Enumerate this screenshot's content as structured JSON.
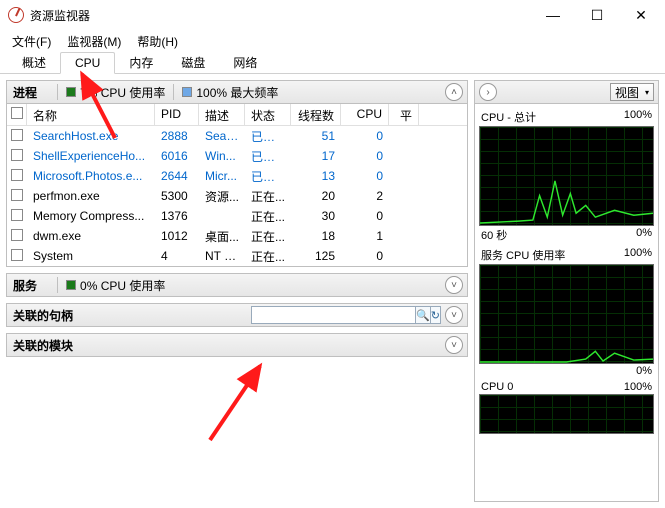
{
  "window": {
    "title": "资源监视器",
    "minimize": "—",
    "maximize": "☐",
    "close": "✕"
  },
  "menu": {
    "file": "文件(F)",
    "monitor": "监视器(M)",
    "help": "帮助(H)"
  },
  "tabs": {
    "overview": "概述",
    "cpu": "CPU",
    "memory": "内存",
    "disk": "磁盘",
    "network": "网络"
  },
  "processesHeader": {
    "title": "进程",
    "usage": "7% CPU 使用率",
    "maxfreq": "100% 最大频率"
  },
  "columns": {
    "name": "名称",
    "pid": "PID",
    "desc": "描述",
    "status": "状态",
    "threads": "线程数",
    "cpu": "CPU",
    "avg": "平"
  },
  "rows": [
    {
      "name": "SearchHost.exe",
      "pid": "2888",
      "desc": "Sear...",
      "status": "已暂停",
      "threads": "51",
      "cpu": "0",
      "blue": true
    },
    {
      "name": "ShellExperienceHo...",
      "pid": "6016",
      "desc": "Win...",
      "status": "已暂停",
      "threads": "17",
      "cpu": "0",
      "blue": true
    },
    {
      "name": "Microsoft.Photos.e...",
      "pid": "2644",
      "desc": "Micr...",
      "status": "已暂停",
      "threads": "13",
      "cpu": "0",
      "blue": true
    },
    {
      "name": "perfmon.exe",
      "pid": "5300",
      "desc": "资源...",
      "status": "正在...",
      "threads": "20",
      "cpu": "2",
      "blue": false
    },
    {
      "name": "Memory Compress...",
      "pid": "1376",
      "desc": "",
      "status": "正在...",
      "threads": "30",
      "cpu": "0",
      "blue": false
    },
    {
      "name": "dwm.exe",
      "pid": "1012",
      "desc": "桌面...",
      "status": "正在...",
      "threads": "18",
      "cpu": "1",
      "blue": false
    },
    {
      "name": "System",
      "pid": "4",
      "desc": "NT K...",
      "status": "正在...",
      "threads": "125",
      "cpu": "0",
      "blue": false
    }
  ],
  "servicesHeader": {
    "title": "服务",
    "usage": "0% CPU 使用率"
  },
  "handlesHeader": {
    "title": "关联的句柄",
    "placeholder": ""
  },
  "modulesHeader": {
    "title": "关联的模块"
  },
  "rightTop": {
    "viewLabel": "视图"
  },
  "charts": {
    "cpuTotal": {
      "title": "CPU - 总计",
      "right": "100%",
      "footLeft": "60 秒",
      "footRight": "0%"
    },
    "cpuService": {
      "title": "服务 CPU 使用率",
      "right": "100%",
      "footLeft": "",
      "footRight": "0%"
    },
    "cpu0": {
      "title": "CPU 0",
      "right": "100%"
    }
  },
  "icons": {
    "collapseUp": "˄",
    "collapseDown": "˅",
    "expandRight": "›",
    "dropdown": "▾",
    "search": "🔍",
    "refresh": "↻"
  }
}
